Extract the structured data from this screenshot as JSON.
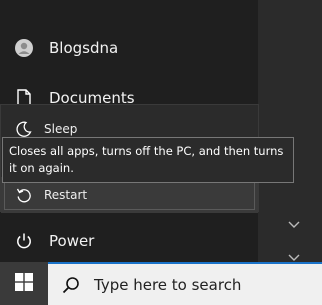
{
  "start_menu": {
    "user_name": "Blogsdna",
    "documents_label": "Documents",
    "power_label": "Power"
  },
  "power_flyout": {
    "items": [
      {
        "label": "Sleep",
        "icon": "moon-icon"
      },
      {
        "label": "Restart",
        "icon": "restart-icon"
      }
    ],
    "tooltip": "Closes all apps, turns off the PC, and then turns it on again."
  },
  "taskbar": {
    "search_placeholder": "Type here to search"
  },
  "colors": {
    "accent": "#1a73c9",
    "background": "#1f1f1f",
    "flyout": "#2b2b2b"
  }
}
